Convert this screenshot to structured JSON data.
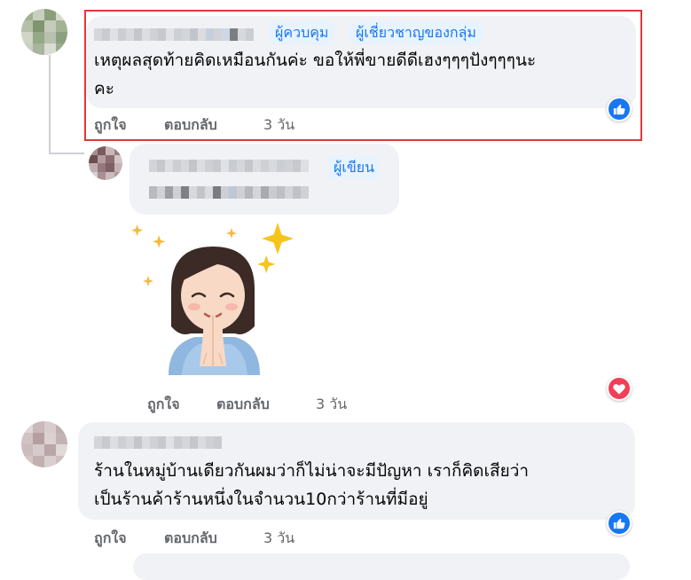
{
  "comments": [
    {
      "badges": [
        "ผู้ควบคุม",
        "ผู้เชี่ยวชาญของกลุ่ม"
      ],
      "text_line1": "เหตุผลสุดท้ายคิดเหมือนกันค่ะ ขอให้พี่ขายดีดีเฮงๆๆๆปังๆๆๆนะ",
      "text_line2": "คะ",
      "like_label": "ถูกใจ",
      "reply_label": "ตอบกลับ",
      "time": "3 วัน",
      "reaction": "like-icon"
    },
    {
      "badges": [
        "ผู้เขียน"
      ],
      "sticker": "woman-praying-sticker",
      "like_label": "ถูกใจ",
      "reply_label": "ตอบกลับ",
      "time": "3 วัน",
      "reaction": "love-icon"
    },
    {
      "text_line1": "ร้านในหมู่บ้านเดียวกันผมว่าก็ไม่น่าจะมีปัญหา เราก็คิดเสียว่า",
      "text_line2": "เป็นร้านค้าร้านหนึ่งในจำนวน10กว่าร้านที่มีอยู่",
      "like_label": "ถูกใจ",
      "reply_label": "ตอบกลับ",
      "time": "3 วัน",
      "reaction": "like-icon"
    }
  ],
  "colors": {
    "bubble": "#f0f2f5",
    "badge_bg": "#e7f3ff",
    "badge_text": "#1877f2",
    "action_text": "#65676b",
    "highlight": "#e0383b",
    "like_blue": "#1877f2",
    "love_red": "#f33e58"
  }
}
